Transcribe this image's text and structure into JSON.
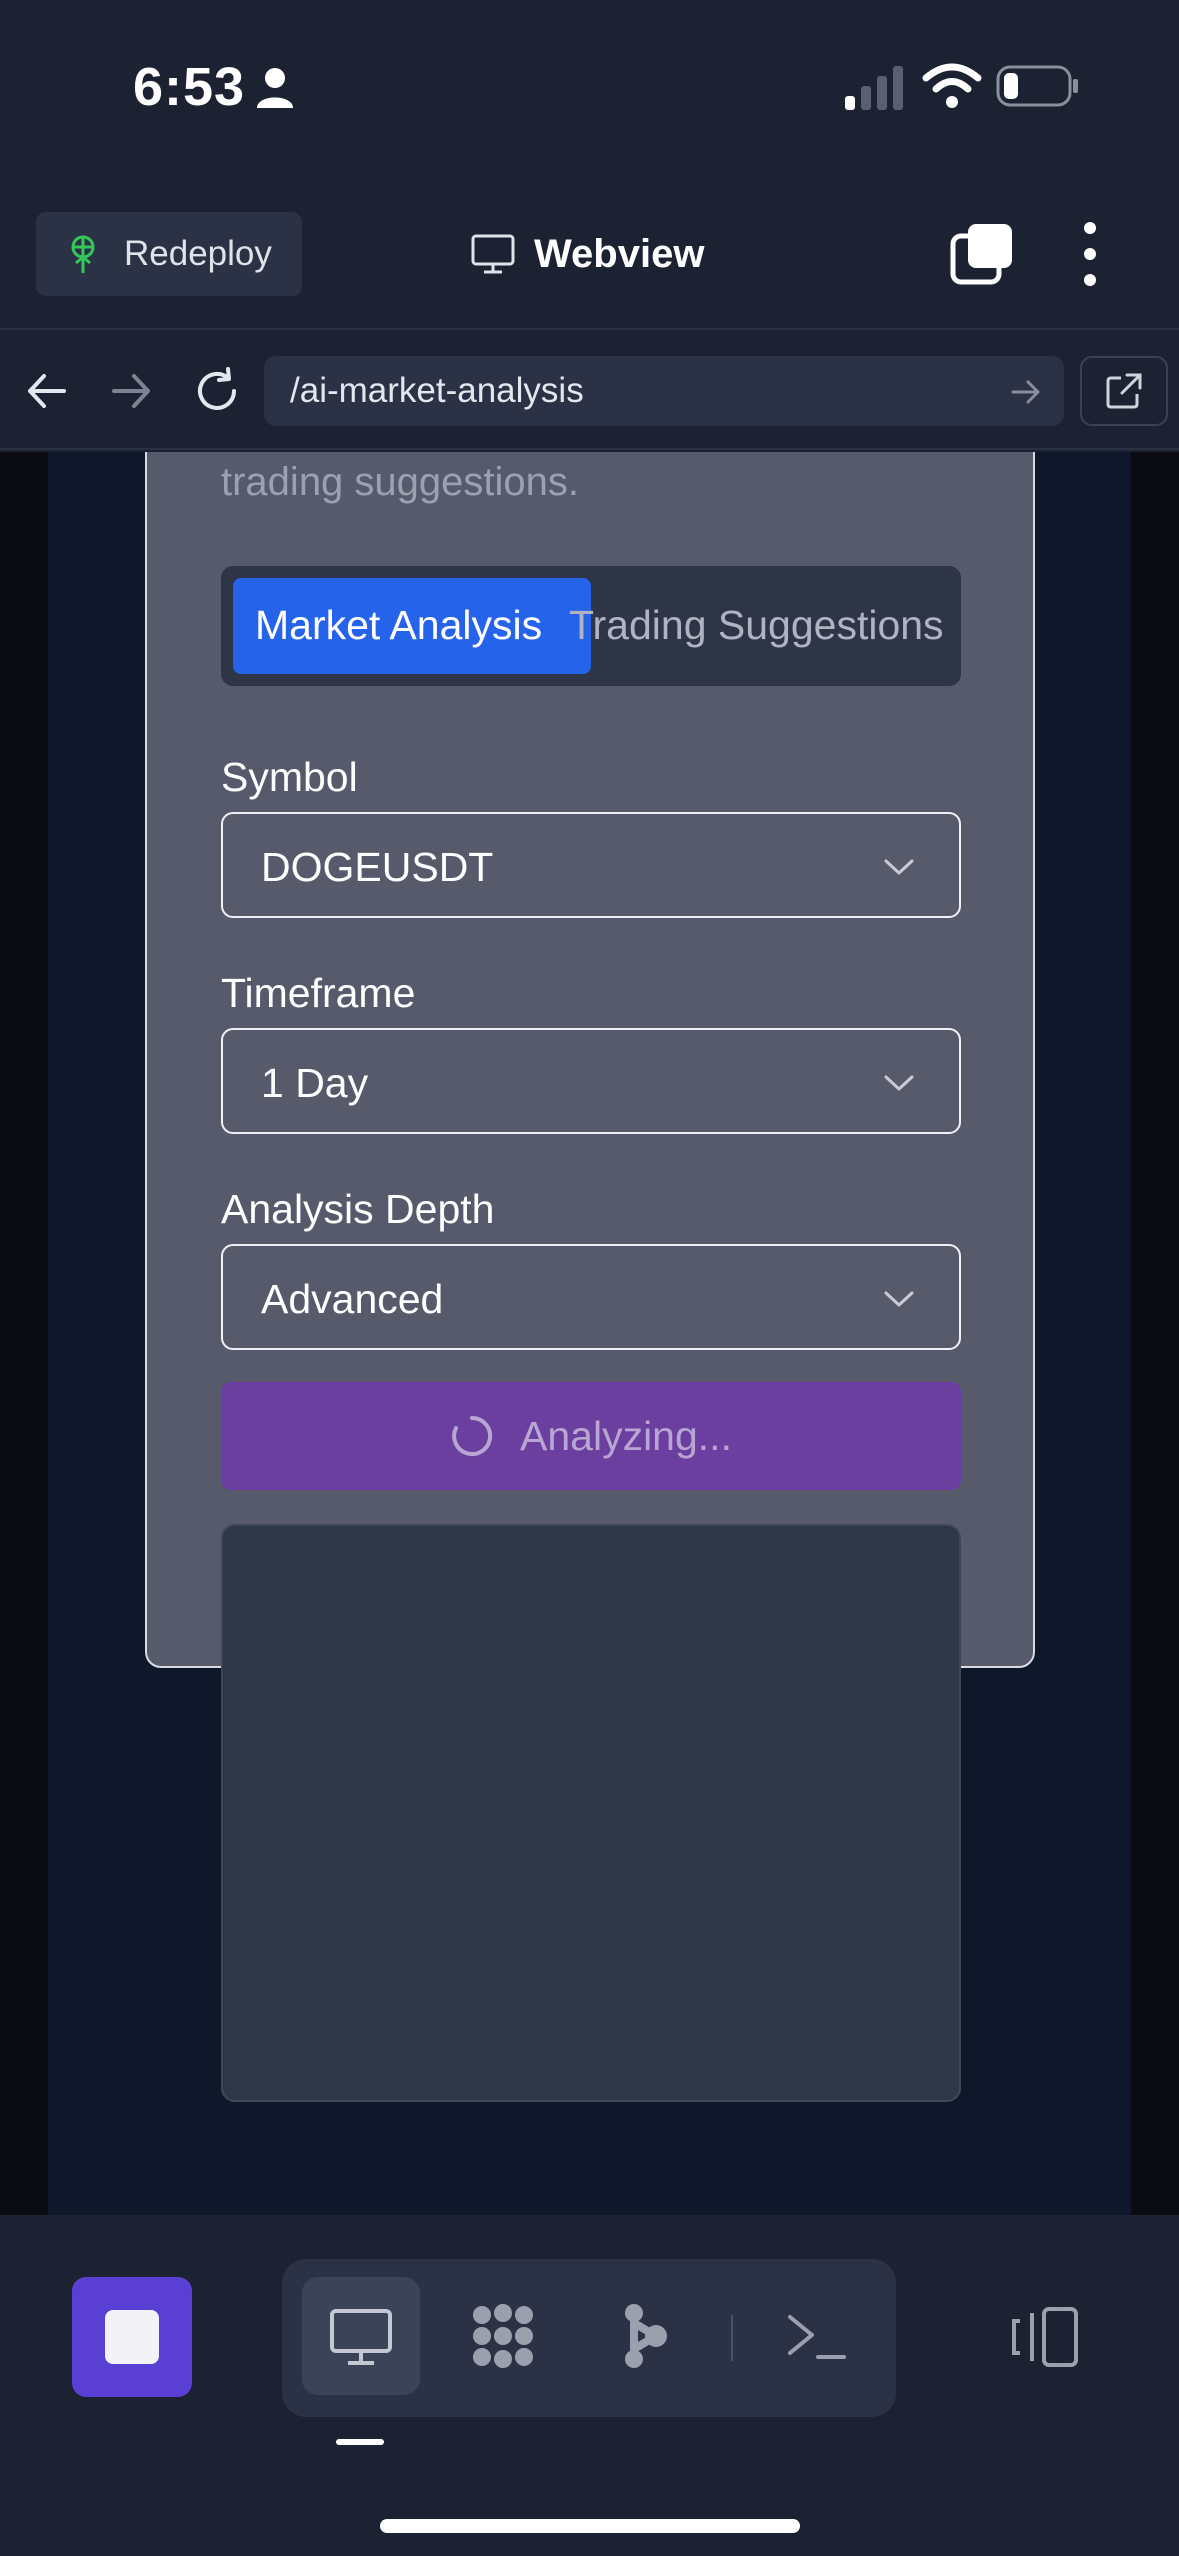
{
  "status_bar": {
    "time": "6:53",
    "icons": [
      "person-icon",
      "signal-icon",
      "wifi-icon",
      "battery-icon"
    ]
  },
  "header": {
    "redeploy_label": "Redeploy",
    "title": "Webview",
    "icons": [
      "sprout-icon",
      "monitor-icon",
      "tabs-icon",
      "more-icon"
    ]
  },
  "browser": {
    "url": "/ai-market-analysis",
    "icons": [
      "back-icon",
      "forward-icon",
      "reload-icon",
      "arrow-right-icon",
      "external-link-icon"
    ]
  },
  "page": {
    "description_fragment": "trading suggestions.",
    "tabs": [
      {
        "label": "Market Analysis",
        "active": true
      },
      {
        "label": "Trading Suggestions",
        "active": false
      }
    ],
    "fields": {
      "symbol": {
        "label": "Symbol",
        "value": "DOGEUSDT"
      },
      "timeframe": {
        "label": "Timeframe",
        "value": "1 Day"
      },
      "depth": {
        "label": "Analysis Depth",
        "value": "Advanced"
      }
    },
    "analyze_button": {
      "label": "Analyzing...",
      "state": "loading"
    },
    "colors": {
      "card": "#565a6b",
      "accent_blue": "#2563eb",
      "button_purple": "#6b3fa0",
      "result_panel": "#2d3748"
    }
  },
  "bottom_toolbar": {
    "icons": [
      "stop-icon",
      "monitor-icon",
      "dots-cluster-icon",
      "graph-nodes-icon",
      "terminal-icon",
      "panels-icon"
    ],
    "active_tool": "monitor-icon"
  }
}
